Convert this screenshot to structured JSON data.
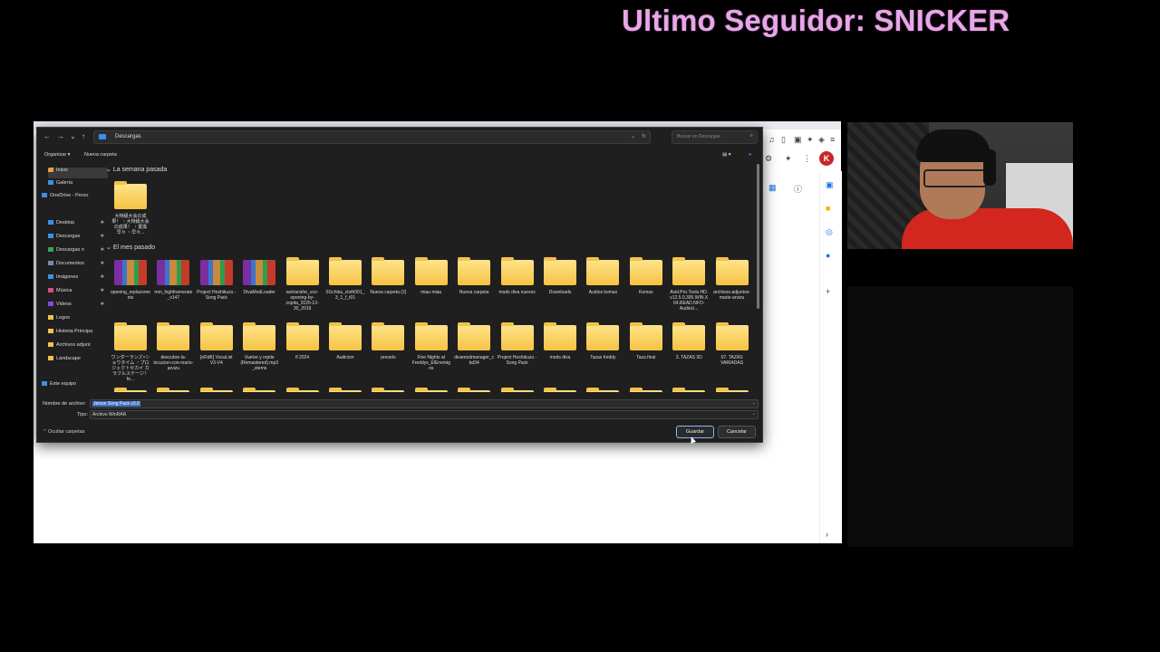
{
  "overlay": {
    "title": "Ultimo Seguidor: SNICKER"
  },
  "browser": {
    "avatar_letter": "K"
  },
  "dialog": {
    "breadcrumb": "Descargas",
    "search_placeholder": "Buscar en Descargas",
    "organize": "Organizar ▾",
    "new_folder": "Nueva carpeta",
    "nav": [
      {
        "label": "Inicio",
        "color": "#e8a33a",
        "pin": ""
      },
      {
        "label": "Galería",
        "color": "#3d8ee6",
        "pin": ""
      },
      {
        "label": "OneDrive - Perso",
        "color": "#3d8ee6",
        "pin": ""
      },
      {
        "label": "Desktop",
        "color": "#3d8ee6",
        "pin": "✱"
      },
      {
        "label": "Descargas",
        "color": "#3d8ee6",
        "pin": "✱"
      },
      {
        "label": "Descargas n",
        "color": "#3da05a",
        "pin": "✱"
      },
      {
        "label": "Documentos",
        "color": "#7a8aa0",
        "pin": "✱"
      },
      {
        "label": "Imágenes",
        "color": "#3d8ee6",
        "pin": "✱"
      },
      {
        "label": "Música",
        "color": "#d0508a",
        "pin": "✱"
      },
      {
        "label": "Videos",
        "color": "#8a4ad0",
        "pin": "✱"
      },
      {
        "label": "Logos",
        "color": "#f2c24a",
        "pin": ""
      },
      {
        "label": "Historia Principa",
        "color": "#f2c24a",
        "pin": ""
      },
      {
        "label": "Archivos adjunt",
        "color": "#f2c24a",
        "pin": ""
      },
      {
        "label": "Landscape",
        "color": "#f2c24a",
        "pin": ""
      },
      {
        "label": "Este equipo",
        "color": "#3d8ee6",
        "pin": ""
      }
    ],
    "groups": [
      "La semana pasada",
      "El mes pasado"
    ],
    "week_items": [
      {
        "name": "大特級大会の成果！ ・大特級大会の成果！ ・置換 早々 ・早々...",
        "kind": "folder"
      }
    ],
    "month_row1": [
      {
        "name": "opening_replacements",
        "kind": "rar"
      },
      {
        "name": "mm_highframerate_v147",
        "kind": "rar"
      },
      {
        "name": "Project Hoshikuzu - Song Pack",
        "kind": "rar"
      },
      {
        "name": "DivaModLoader",
        "kind": "rar"
      },
      {
        "name": "wetransfer_voz-opening-by-zopita_2025-12-30_2019",
        "kind": "folder"
      },
      {
        "name": "01ichika_cloth001_3_1_f_t01",
        "kind": "folder"
      },
      {
        "name": "Nueva carpeta (2)",
        "kind": "folder"
      },
      {
        "name": "miau miau",
        "kind": "folder"
      },
      {
        "name": "Nueva carpeta",
        "kind": "folder"
      },
      {
        "name": "mods diva nuevos",
        "kind": "folder"
      },
      {
        "name": "Downloads",
        "kind": "folder"
      },
      {
        "name": "Audios komas",
        "kind": "folder"
      },
      {
        "name": "Komas",
        "kind": "folder"
      },
      {
        "name": "Avid.Pro.Tools.HD.v12.5.0.395.WIN.X64.READ.NFO-AudioU...",
        "kind": "folder"
      },
      {
        "name": "archivos-adjuntos-mario-arvizu",
        "kind": "folder"
      }
    ],
    "month_row2": [
      {
        "name": "ワンダーランズ×ショウタイム ・プロジェクトセカイ カラフルステージ！ fe...",
        "kind": "folder"
      },
      {
        "name": "descubre-la-locucion-con-mario-arvizu",
        "kind": "folder"
      },
      {
        "name": "[eRdK] VocaList V3-V4",
        "kind": "folder"
      },
      {
        "name": "Vuelve y repite (Remastered).mp3_stems",
        "kind": "folder"
      },
      {
        "name": "fl 2024",
        "kind": "folder"
      },
      {
        "name": "Audicion",
        "kind": "folder"
      },
      {
        "name": "presets",
        "kind": "folder"
      },
      {
        "name": "Five Nights at Freddys_ElEnemigos",
        "kind": "folder"
      },
      {
        "name": "divamodmanager_cbd34",
        "kind": "folder"
      },
      {
        "name": "Project Hoshikuzu - Song Pack",
        "kind": "folder"
      },
      {
        "name": "mods diva",
        "kind": "folder"
      },
      {
        "name": "Tazas freddy",
        "kind": "folder"
      },
      {
        "name": "Taza final",
        "kind": "folder"
      },
      {
        "name": "3. TAZAS 3D",
        "kind": "folder"
      },
      {
        "name": "07. TAZAS VARIADAS",
        "kind": "folder"
      }
    ],
    "filename_label": "Nombre de archivo:",
    "filename_value": "Jeison Song Pack v3.0",
    "type_label": "Tipo:",
    "type_value": "Archivo WinRAR",
    "hide_folders": "Ocultar carpetas",
    "save": "Guardar",
    "cancel": "Cancelar"
  }
}
